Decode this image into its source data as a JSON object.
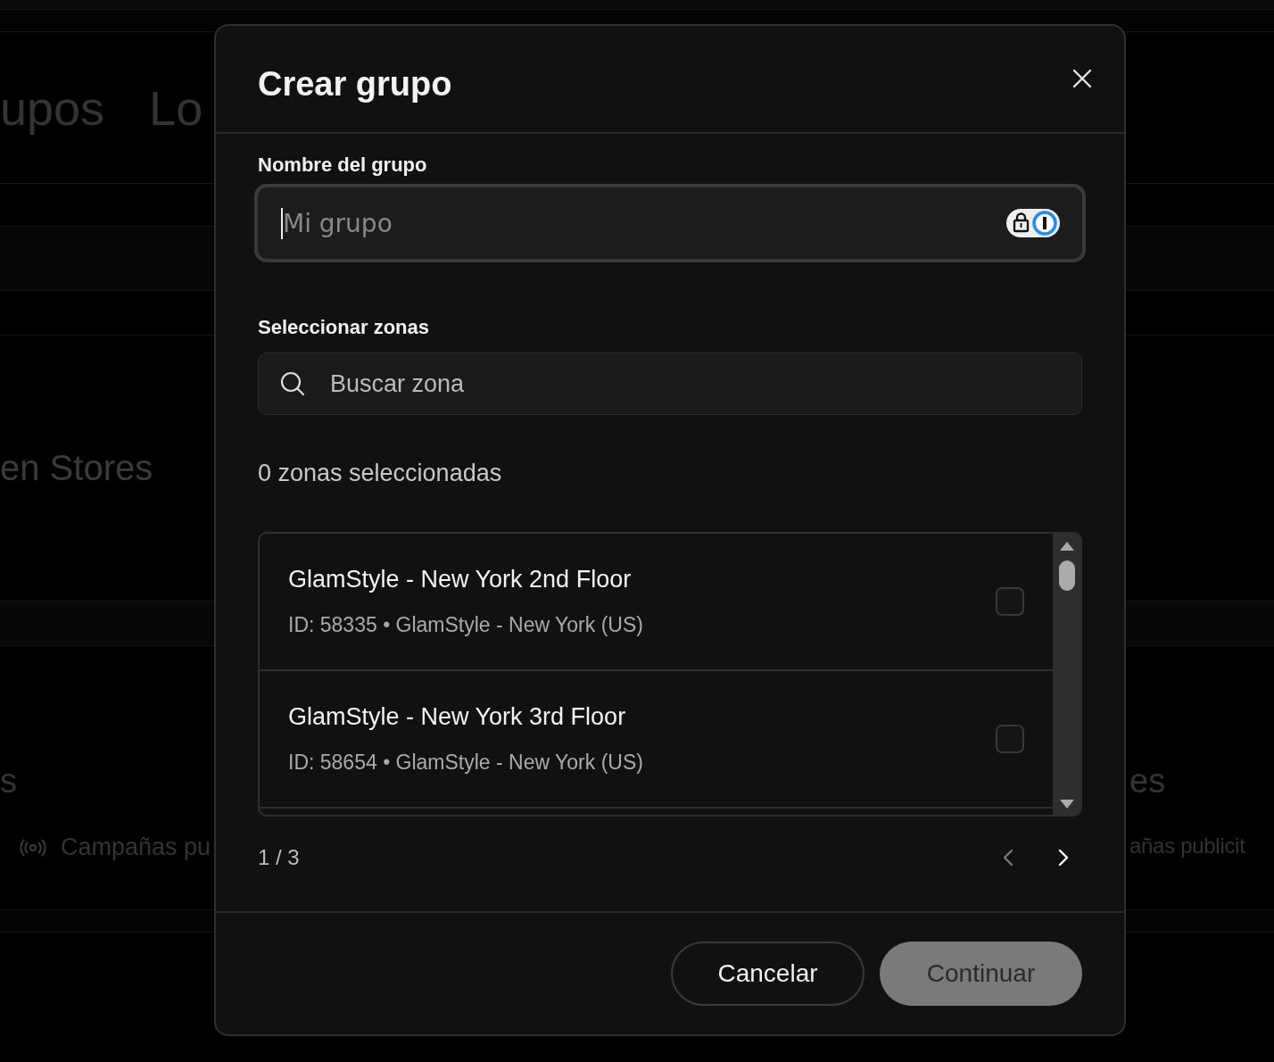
{
  "background": {
    "tabs": [
      "upos",
      "Lo"
    ],
    "store_name": "en Stores",
    "left_card": {
      "title": "s",
      "item": "Campañas pu"
    },
    "right_card": {
      "title": "es",
      "item": "añas publicit"
    }
  },
  "dialog": {
    "title": "Crear grupo",
    "name_field": {
      "label": "Nombre del grupo",
      "placeholder": "Mi grupo"
    },
    "zones": {
      "label": "Seleccionar zonas",
      "search_placeholder": "Buscar zona",
      "selected_count": "0 zonas seleccionadas",
      "items": [
        {
          "name": "GlamStyle - New York 2nd Floor",
          "details": "ID: 58335 • GlamStyle - New York (US)",
          "checked": false
        },
        {
          "name": "GlamStyle - New York 3rd Floor",
          "details": "ID: 58654 • GlamStyle - New York (US)",
          "checked": false
        }
      ],
      "page": "1 / 3",
      "prev_disabled": true,
      "next_disabled": false
    },
    "buttons": [
      {
        "label": "Cancelar",
        "kind": "secondary",
        "disabled": false
      },
      {
        "label": "Continuar",
        "kind": "primary",
        "disabled": true
      }
    ]
  }
}
